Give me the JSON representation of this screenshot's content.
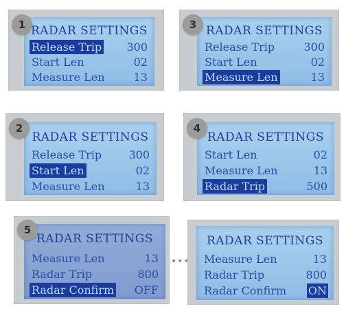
{
  "panels": [
    {
      "badge": "1",
      "title": "RADAR SETTINGS",
      "rows": [
        {
          "label": "Release Trip",
          "value": "300"
        },
        {
          "label": "Start Len",
          "value": "02"
        },
        {
          "label": "Measure Len",
          "value": "13"
        }
      ]
    },
    {
      "badge": "3",
      "title": "RADAR SETTINGS",
      "rows": [
        {
          "label": "Release Trip",
          "value": "300"
        },
        {
          "label": "Start Len",
          "value": "02"
        },
        {
          "label": "Measure Len",
          "value": "13"
        }
      ]
    },
    {
      "badge": "2",
      "title": "RADAR SETTINGS",
      "rows": [
        {
          "label": "Release Trip",
          "value": "300"
        },
        {
          "label": "Start Len",
          "value": "02"
        },
        {
          "label": "Measure Len",
          "value": "13"
        }
      ]
    },
    {
      "badge": "4",
      "title": "RADAR SETTINGS",
      "rows": [
        {
          "label": "Start Len",
          "value": "02"
        },
        {
          "label": "Measure Len",
          "value": "13"
        },
        {
          "label": "Radar Trip",
          "value": "500"
        }
      ]
    },
    {
      "badge": "5",
      "title": "RADAR SETTINGS",
      "rows": [
        {
          "label": "Measure Len",
          "value": "13"
        },
        {
          "label": "Radar Trip",
          "value": "800"
        },
        {
          "label": "Radar Confirm",
          "value": "OFF"
        }
      ]
    },
    {
      "badge": "",
      "title": "RADAR SETTINGS",
      "rows": [
        {
          "label": "Measure Len",
          "value": "13"
        },
        {
          "label": "Radar Trip",
          "value": "800"
        },
        {
          "label": "Radar Confirm",
          "value": "ON"
        }
      ]
    }
  ],
  "separator": "•••"
}
